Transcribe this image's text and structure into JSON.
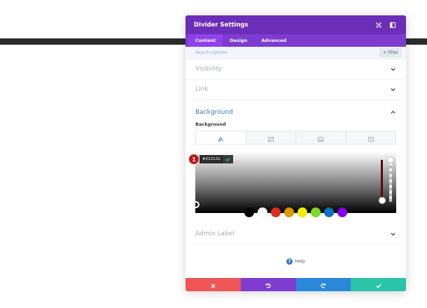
{
  "modal": {
    "title": "Divider Settings",
    "tabs": [
      {
        "label": "Content",
        "active": true
      },
      {
        "label": "Design",
        "active": false
      },
      {
        "label": "Advanced",
        "active": false
      }
    ],
    "search_placeholder": "Search Options",
    "filter_label": "+ Filter",
    "toggles": {
      "visibility": "Visibility",
      "link": "Link",
      "admin_label": "Admin Label"
    },
    "background": {
      "title": "Background",
      "sublabel": "Background",
      "tab_icons": [
        "color-icon",
        "gradient-icon",
        "image-icon",
        "video-icon"
      ],
      "color_hex": "#212121",
      "step_badge": "1",
      "swatches": [
        "#000000",
        "#ffffff",
        "#e02b20",
        "#e09900",
        "#edf000",
        "#7cda24",
        "#0c71c3",
        "#8300e9"
      ]
    },
    "help_label": "Help",
    "footer": {
      "colors": [
        "#ef5555",
        "#7e3bd0",
        "#2b87da",
        "#29c4a9"
      ],
      "icons": [
        "close-icon",
        "undo-icon",
        "redo-icon",
        "check-icon"
      ]
    }
  },
  "colors": {
    "header": "#6c2eb9",
    "tabs": "#7e3bd0",
    "accent_blue": "#3c7ab4",
    "divider_bar": "#2b2b2b"
  }
}
